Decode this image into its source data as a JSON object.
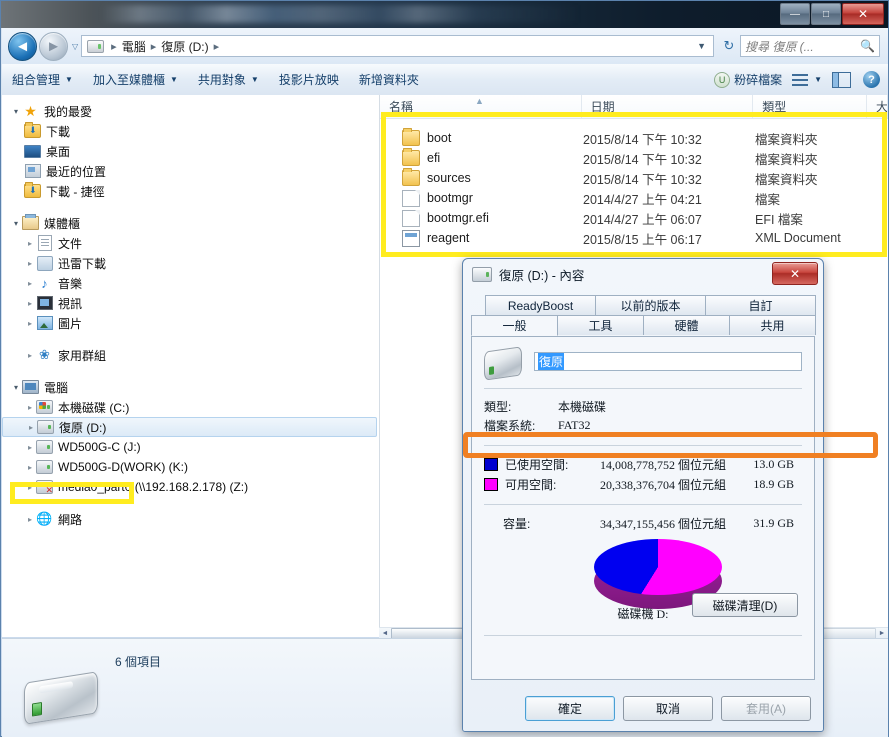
{
  "window": {
    "title": "",
    "controls": {
      "minimize": "—",
      "maximize": "□",
      "close": "✕"
    }
  },
  "address": {
    "back_icon": "back-arrow-icon",
    "forward_icon": "forward-arrow-icon",
    "crumbs": [
      "電腦",
      "復原 (D:)"
    ],
    "separator": "▸",
    "refresh_icon": "refresh-icon"
  },
  "search": {
    "placeholder": "搜尋 復原 (...",
    "icon": "search-icon"
  },
  "toolbar": {
    "items": [
      {
        "label": "組合管理",
        "has_caret": true
      },
      {
        "label": "加入至媒體櫃",
        "has_caret": true
      },
      {
        "label": "共用對象",
        "has_caret": true
      },
      {
        "label": "投影片放映",
        "has_caret": false
      },
      {
        "label": "新增資料夾",
        "has_caret": false
      }
    ],
    "shred_label": "粉碎檔案",
    "shred_badge": "U",
    "view_icon": "view-options-icon",
    "view_caret": "▼",
    "preview_icon": "preview-pane-icon",
    "help_icon": "help-icon"
  },
  "navpane": {
    "groups": [
      {
        "header": {
          "label": "我的最愛",
          "icon": "star-icon",
          "expander": "▾"
        },
        "items": [
          {
            "label": "下載",
            "icon": "downloads-folder-icon"
          },
          {
            "label": "桌面",
            "icon": "desktop-icon"
          },
          {
            "label": "最近的位置",
            "icon": "recent-places-icon"
          },
          {
            "label": "下載 - 捷徑",
            "icon": "downloads-shortcut-icon"
          }
        ]
      },
      {
        "header": {
          "label": "媒體櫃",
          "icon": "library-icon",
          "expander": "▾"
        },
        "items": [
          {
            "label": "文件",
            "icon": "documents-icon",
            "expander": "▸"
          },
          {
            "label": "迅雷下載",
            "icon": "thunder-download-icon",
            "expander": "▸"
          },
          {
            "label": "音樂",
            "icon": "music-icon",
            "expander": "▸"
          },
          {
            "label": "視訊",
            "icon": "video-icon",
            "expander": "▸"
          },
          {
            "label": "圖片",
            "icon": "pictures-icon",
            "expander": "▸"
          }
        ]
      },
      {
        "header": {
          "label": "家用群組",
          "icon": "homegroup-icon",
          "expander": "▸"
        },
        "items": []
      },
      {
        "header": {
          "label": "電腦",
          "icon": "computer-icon",
          "expander": "▾"
        },
        "items": [
          {
            "label": "本機磁碟 (C:)",
            "icon": "system-drive-icon",
            "expander": "▸"
          },
          {
            "label": "復原 (D:)",
            "icon": "drive-icon",
            "expander": "▸",
            "selected": true
          },
          {
            "label": "WD500G-C (J:)",
            "icon": "drive-icon",
            "expander": "▸"
          },
          {
            "label": "WD500G-D(WORK) (K:)",
            "icon": "drive-icon",
            "expander": "▸"
          },
          {
            "label": "media0_part0 (\\\\192.168.2.178) (Z:)",
            "icon": "network-drive-disconnected-icon",
            "expander": "▸"
          }
        ]
      },
      {
        "header": {
          "label": "網路",
          "icon": "network-icon",
          "expander": "▸"
        },
        "items": []
      }
    ]
  },
  "filelist": {
    "columns": [
      "名稱",
      "日期",
      "類型",
      "大"
    ],
    "sort_indicator": "▲",
    "rows": [
      {
        "name": "boot",
        "date": "2015/8/14 下午 10:32",
        "type": "檔案資料夾",
        "icon": "folder-icon"
      },
      {
        "name": "efi",
        "date": "2015/8/14 下午 10:32",
        "type": "檔案資料夾",
        "icon": "folder-icon"
      },
      {
        "name": "sources",
        "date": "2015/8/14 下午 10:32",
        "type": "檔案資料夾",
        "icon": "folder-icon"
      },
      {
        "name": "bootmgr",
        "date": "2014/4/27 上午 04:21",
        "type": "檔案",
        "icon": "file-icon"
      },
      {
        "name": "bootmgr.efi",
        "date": "2014/4/27 上午 06:07",
        "type": "EFI 檔案",
        "icon": "file-icon"
      },
      {
        "name": "reagent",
        "date": "2015/8/15 上午 06:17",
        "type": "XML Document",
        "icon": "xml-file-icon"
      }
    ]
  },
  "statusbar": {
    "item_count": "6 個項目",
    "drive_icon": "external-drive-icon"
  },
  "dialog": {
    "title": "復原 (D:) - 內容",
    "close_label": "✕",
    "tabs_top": [
      "ReadyBoost",
      "以前的版本",
      "自訂"
    ],
    "tabs_bottom": [
      "一般",
      "工具",
      "硬體",
      "共用"
    ],
    "active_tab": "一般",
    "volume_label": "復原",
    "fields": [
      {
        "key": "類型:",
        "value": "本機磁碟"
      },
      {
        "key": "檔案系統:",
        "value": "FAT32"
      }
    ],
    "stats": [
      {
        "label": "已使用空間:",
        "bytes": "14,008,778,752 個位元組",
        "gb": "13.0 GB",
        "color": "#0000d0"
      },
      {
        "label": "可用空間:",
        "bytes": "20,338,376,704 個位元組",
        "gb": "18.9 GB",
        "color": "#ff00ff"
      }
    ],
    "capacity": {
      "label": "容量:",
      "bytes": "34,347,155,456 個位元組",
      "gb": "31.9 GB"
    },
    "pie_label": "磁碟機 D:",
    "cleanup_button": "磁碟清理(D)",
    "buttons": {
      "ok": "確定",
      "cancel": "取消",
      "apply": "套用(A)"
    }
  },
  "highlights": {
    "yellow_color": "#ffec1f",
    "orange_color": "#f08023"
  },
  "chart_data": {
    "type": "pie",
    "title": "磁碟機 D:",
    "categories": [
      "已使用空間",
      "可用空間"
    ],
    "values": [
      14008778752,
      20338376704
    ],
    "value_labels": [
      "13.0 GB",
      "18.9 GB"
    ],
    "colors": [
      "#0000d0",
      "#ff00ff"
    ],
    "total": 34347155456,
    "total_label": "31.9 GB",
    "percentages": [
      40.8,
      59.2
    ],
    "legend_position": "above"
  }
}
